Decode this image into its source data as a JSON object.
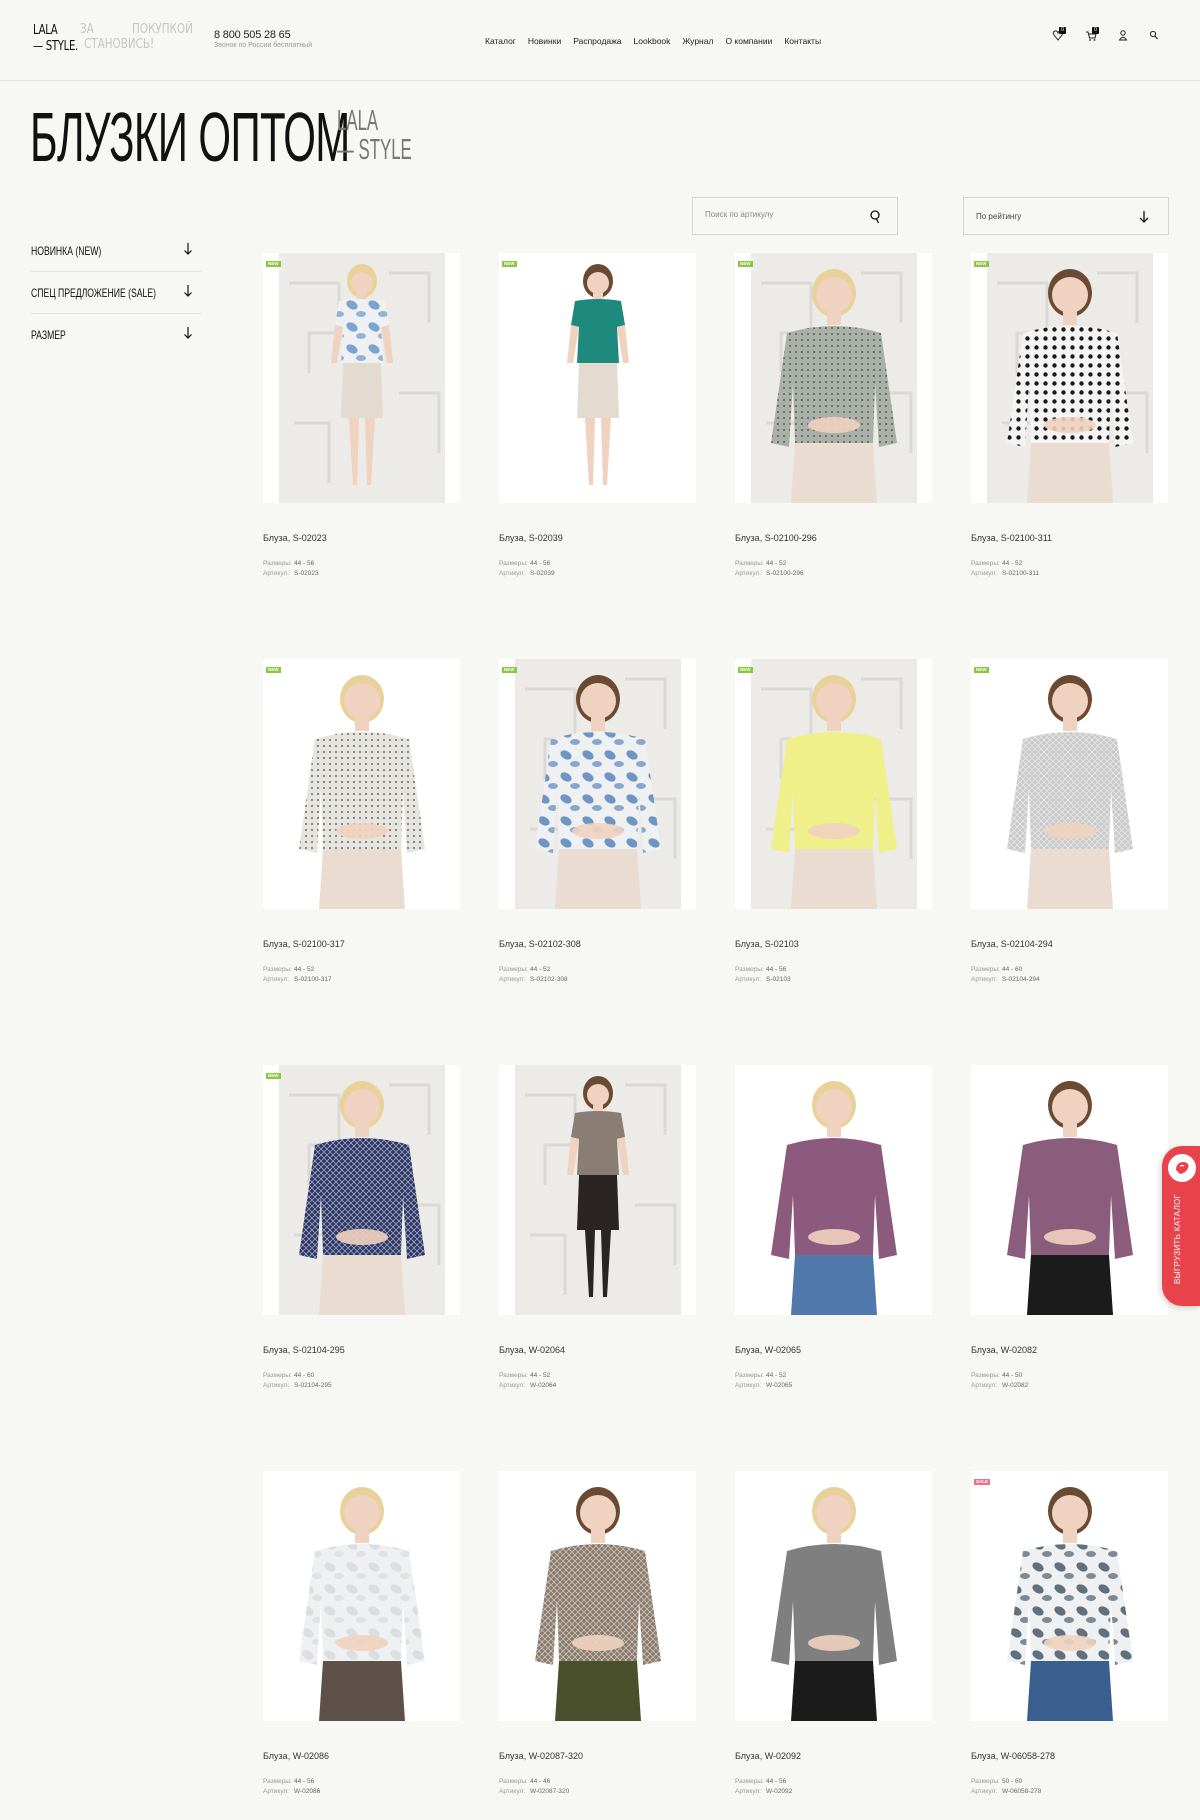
{
  "header": {
    "logo_line1": "LALA",
    "logo_line2": "— STYLE.",
    "slogan": [
      "ЗА",
      "ПОКУПКОЙ",
      "СТАНОВИСЬ!"
    ],
    "phone": "8 800 505 28 65",
    "phone_note": "Звонок по России бесплатный",
    "nav": [
      "Каталог",
      "Новинки",
      "Распродажа",
      "Lookbook",
      "Журнал",
      "О компании",
      "Контакты"
    ],
    "icons": [
      {
        "name": "favorites-icon",
        "badge": "0"
      },
      {
        "name": "cart-icon",
        "badge": "0"
      },
      {
        "name": "user-icon",
        "badge": ""
      },
      {
        "name": "search-icon",
        "badge": ""
      }
    ]
  },
  "title": "БЛУЗКИ ОПТОМ",
  "brand_mark": [
    "LALA",
    "— STYLE"
  ],
  "filters": [
    "НОВИНКА (NEW)",
    "СПЕЦ ПРЕДЛОЖЕНИЕ (SALE)",
    "РАЗМЕР"
  ],
  "search": {
    "placeholder": "Поиск по артикулу"
  },
  "sort": {
    "label": "По рейтингу"
  },
  "meta_labels": {
    "sizes": "Размеры:",
    "article": "Артикул:"
  },
  "products": [
    {
      "name": "Блуза, S-02023",
      "sizes": "44 - 56",
      "article": "S-02023",
      "tag": "NEW",
      "top_color": "#7aa3cf",
      "bottom_color": "#e3dbd0",
      "pattern": "floral",
      "full_body": true
    },
    {
      "name": "Блуза, S-02039",
      "sizes": "44 - 56",
      "article": "S-02039",
      "tag": "NEW",
      "top_color": "#1e8a7e",
      "bottom_color": "#e3dbd0",
      "pattern": "solid",
      "full_body": true
    },
    {
      "name": "Блуза, S-02100-296",
      "sizes": "44 - 52",
      "article": "S-02100-296",
      "tag": "NEW",
      "top_color": "#a9b0a8",
      "bottom_color": "#eadcd0",
      "pattern": "dots",
      "full_body": false
    },
    {
      "name": "Блуза, S-02100-311",
      "sizes": "44 - 52",
      "article": "S-02100-311",
      "tag": "NEW",
      "top_color": "#f4f4f4",
      "bottom_color": "#eadcd0",
      "pattern": "bigdots",
      "full_body": false
    },
    {
      "name": "Блуза, S-02100-317",
      "sizes": "44 - 52",
      "article": "S-02100-317",
      "tag": "NEW",
      "top_color": "#e6e4de",
      "bottom_color": "#eadcd0",
      "pattern": "dots",
      "full_body": false
    },
    {
      "name": "Блуза, S-02102-308",
      "sizes": "44 - 52",
      "article": "S-02102-308",
      "tag": "NEW",
      "top_color": "#6f95c4",
      "bottom_color": "#eadcd0",
      "pattern": "floral",
      "full_body": false
    },
    {
      "name": "Блуза, S-02103",
      "sizes": "44 - 56",
      "article": "S-02103",
      "tag": "NEW",
      "top_color": "#f0f08a",
      "bottom_color": "#eadcd0",
      "pattern": "solid",
      "full_body": false
    },
    {
      "name": "Блуза, S-02104-294",
      "sizes": "44 - 60",
      "article": "S-02104-294",
      "tag": "NEW",
      "top_color": "#c9c9c9",
      "bottom_color": "#eadcd0",
      "pattern": "check",
      "full_body": false
    },
    {
      "name": "Блуза, S-02104-295",
      "sizes": "44 - 60",
      "article": "S-02104-295",
      "tag": "NEW",
      "top_color": "#2b3566",
      "bottom_color": "#eadcd0",
      "pattern": "check",
      "full_body": false
    },
    {
      "name": "Блуза, W-02064",
      "sizes": "44 - 52",
      "article": "W-02064",
      "tag": "",
      "top_color": "#8a7d74",
      "bottom_color": "#2a2422",
      "pattern": "solid",
      "full_body": true
    },
    {
      "name": "Блуза, W-02065",
      "sizes": "44 - 52",
      "article": "W-02065",
      "tag": "",
      "top_color": "#8c5a7d",
      "bottom_color": "#4f79aa",
      "pattern": "solid",
      "full_body": false
    },
    {
      "name": "Блуза, W-02082",
      "sizes": "44 - 50",
      "article": "W-02082",
      "tag": "",
      "top_color": "#8a5d7c",
      "bottom_color": "#1b1b1b",
      "pattern": "solid",
      "full_body": false
    },
    {
      "name": "Блуза, W-02086",
      "sizes": "44 - 56",
      "article": "W-02086",
      "tag": "",
      "top_color": "#d9dee2",
      "bottom_color": "#5e514a",
      "pattern": "floral",
      "full_body": false
    },
    {
      "name": "Блуза, W-02087-320",
      "sizes": "44 - 46",
      "article": "W-02087-320",
      "tag": "",
      "top_color": "#8a7a6a",
      "bottom_color": "#4a4f2c",
      "pattern": "check",
      "full_body": false
    },
    {
      "name": "Блуза, W-02092",
      "sizes": "44 - 56",
      "article": "W-02092",
      "tag": "",
      "top_color": "#7f7f7f",
      "bottom_color": "#1b1b1b",
      "pattern": "solid",
      "full_body": false
    },
    {
      "name": "Блуза, W-06058-278",
      "sizes": "50 - 60",
      "article": "W-06058-278",
      "tag": "SALE",
      "top_color": "#60707c",
      "bottom_color": "#3a5f8f",
      "pattern": "floral",
      "full_body": false
    }
  ],
  "catalog_button": {
    "label": "ВЫГРУЗИТЬ КАТАЛОГ"
  },
  "colors": {
    "background": "#f7f7f3",
    "new_tag": "#8cc63f",
    "sale_tag": "#f06f8a",
    "catalog_tab": "#e8434a"
  }
}
